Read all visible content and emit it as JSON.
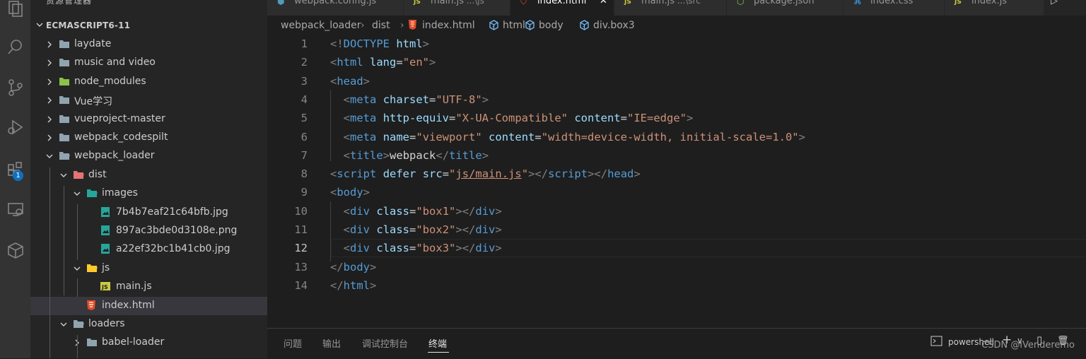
{
  "sidebar": {
    "title": "资源管理器",
    "more": "···",
    "section": "ECMASCRIPT6-11",
    "items": [
      {
        "label": "laydate",
        "type": "folder"
      },
      {
        "label": "music and video",
        "type": "folder"
      },
      {
        "label": "node_modules",
        "type": "folder"
      },
      {
        "label": "Vue学习",
        "type": "folder"
      },
      {
        "label": "vueproject-master",
        "type": "folder"
      },
      {
        "label": "webpack_codespilt",
        "type": "folder"
      },
      {
        "label": "webpack_loader",
        "type": "folder-open"
      },
      {
        "label": "dist",
        "type": "folder-open"
      },
      {
        "label": "images",
        "type": "folder-open"
      },
      {
        "label": "7b4b7eaf21c64bfb.jpg",
        "type": "image"
      },
      {
        "label": "897ac3bde0d3108e.png",
        "type": "image"
      },
      {
        "label": "a22ef32bc1b41cb0.jpg",
        "type": "image"
      },
      {
        "label": "js",
        "type": "folder-open"
      },
      {
        "label": "main.js",
        "type": "js"
      },
      {
        "label": "index.html",
        "type": "html"
      },
      {
        "label": "loaders",
        "type": "folder-open"
      },
      {
        "label": "babel-loader",
        "type": "folder"
      }
    ]
  },
  "activity": {
    "badge": "1",
    "icons": [
      "explorer-icon",
      "search-icon",
      "source-control-icon",
      "run-debug-icon",
      "extensions-icon",
      "remote-explorer-icon",
      "package-icon"
    ]
  },
  "tabs": [
    {
      "label": "webpack.config.js",
      "detail": "",
      "icon": "gear-icon",
      "icon_color": "#519aba"
    },
    {
      "label": "main.js",
      "detail": "...\\js",
      "icon": "js-icon",
      "icon_color": "#cbcb41"
    },
    {
      "label": "index.html",
      "detail": "",
      "icon": "html-icon",
      "icon_color": "#e44d26",
      "active": true
    },
    {
      "label": "main.js",
      "detail": "...\\src",
      "icon": "js-icon",
      "icon_color": "#cbcb41"
    },
    {
      "label": "package.json",
      "detail": "",
      "icon": "node-icon",
      "icon_color": "#8bc34a"
    },
    {
      "label": "index.css",
      "detail": "",
      "icon": "css-icon",
      "icon_color": "#42a5f5"
    },
    {
      "label": "index.js",
      "detail": "",
      "icon": "js-icon",
      "icon_color": "#cbcb41"
    }
  ],
  "breadcrumb": [
    "webpack_loader",
    "dist",
    "index.html",
    "html",
    "body",
    "div.box3"
  ],
  "editor": {
    "current_line": 12,
    "lines": [
      {
        "n": "1",
        "tokens": [
          [
            "punc",
            "<!"
          ],
          [
            "tag",
            "DOCTYPE"
          ],
          [
            "txt",
            " "
          ],
          [
            "attr",
            "html"
          ],
          [
            "punc",
            ">"
          ]
        ]
      },
      {
        "n": "2",
        "tokens": [
          [
            "punc",
            "<"
          ],
          [
            "tag",
            "html"
          ],
          [
            "txt",
            " "
          ],
          [
            "attr",
            "lang"
          ],
          [
            "txt",
            "="
          ],
          [
            "str",
            "\"en\""
          ],
          [
            "punc",
            ">"
          ]
        ]
      },
      {
        "n": "3",
        "tokens": [
          [
            "punc",
            "<"
          ],
          [
            "tag",
            "head"
          ],
          [
            "punc",
            ">"
          ]
        ]
      },
      {
        "n": "4",
        "tokens": [
          [
            "txt",
            "  "
          ],
          [
            "punc",
            "<"
          ],
          [
            "tag",
            "meta"
          ],
          [
            "txt",
            " "
          ],
          [
            "attr",
            "charset"
          ],
          [
            "txt",
            "="
          ],
          [
            "str",
            "\"UTF-8\""
          ],
          [
            "punc",
            ">"
          ]
        ]
      },
      {
        "n": "5",
        "tokens": [
          [
            "txt",
            "  "
          ],
          [
            "punc",
            "<"
          ],
          [
            "tag",
            "meta"
          ],
          [
            "txt",
            " "
          ],
          [
            "attr",
            "http-equiv"
          ],
          [
            "txt",
            "="
          ],
          [
            "str",
            "\"X-UA-Compatible\""
          ],
          [
            "txt",
            " "
          ],
          [
            "attr",
            "content"
          ],
          [
            "txt",
            "="
          ],
          [
            "str",
            "\"IE=edge\""
          ],
          [
            "punc",
            ">"
          ]
        ]
      },
      {
        "n": "6",
        "tokens": [
          [
            "txt",
            "  "
          ],
          [
            "punc",
            "<"
          ],
          [
            "tag",
            "meta"
          ],
          [
            "txt",
            " "
          ],
          [
            "attr",
            "name"
          ],
          [
            "txt",
            "="
          ],
          [
            "str",
            "\"viewport\""
          ],
          [
            "txt",
            " "
          ],
          [
            "attr",
            "content"
          ],
          [
            "txt",
            "="
          ],
          [
            "str",
            "\"width=device-width, initial-scale=1.0\""
          ],
          [
            "punc",
            ">"
          ]
        ]
      },
      {
        "n": "7",
        "tokens": [
          [
            "txt",
            "  "
          ],
          [
            "punc",
            "<"
          ],
          [
            "tag",
            "title"
          ],
          [
            "punc",
            ">"
          ],
          [
            "txt",
            "webpack"
          ],
          [
            "punc",
            "</"
          ],
          [
            "tag",
            "title"
          ],
          [
            "punc",
            ">"
          ]
        ]
      },
      {
        "n": "8",
        "tokens": [
          [
            "punc",
            "<"
          ],
          [
            "tag",
            "script"
          ],
          [
            "txt",
            " "
          ],
          [
            "attr",
            "defer"
          ],
          [
            "txt",
            " "
          ],
          [
            "attr",
            "src"
          ],
          [
            "txt",
            "="
          ],
          [
            "str",
            "\""
          ],
          [
            "strlink",
            "js/main.js"
          ],
          [
            "str",
            "\""
          ],
          [
            "punc",
            "></"
          ],
          [
            "tag",
            "script"
          ],
          [
            "punc",
            "></"
          ],
          [
            "tag",
            "head"
          ],
          [
            "punc",
            ">"
          ]
        ]
      },
      {
        "n": "9",
        "tokens": [
          [
            "punc",
            "<"
          ],
          [
            "tag",
            "body"
          ],
          [
            "punc",
            ">"
          ]
        ]
      },
      {
        "n": "10",
        "tokens": [
          [
            "txt",
            "  "
          ],
          [
            "punc",
            "<"
          ],
          [
            "tag",
            "div"
          ],
          [
            "txt",
            " "
          ],
          [
            "attr",
            "class"
          ],
          [
            "txt",
            "="
          ],
          [
            "str",
            "\"box1\""
          ],
          [
            "punc",
            "></"
          ],
          [
            "tag",
            "div"
          ],
          [
            "punc",
            ">"
          ]
        ]
      },
      {
        "n": "11",
        "tokens": [
          [
            "txt",
            "  "
          ],
          [
            "punc",
            "<"
          ],
          [
            "tag",
            "div"
          ],
          [
            "txt",
            " "
          ],
          [
            "attr",
            "class"
          ],
          [
            "txt",
            "="
          ],
          [
            "str",
            "\"box2\""
          ],
          [
            "punc",
            "></"
          ],
          [
            "tag",
            "div"
          ],
          [
            "punc",
            ">"
          ]
        ]
      },
      {
        "n": "12",
        "tokens": [
          [
            "txt",
            "  "
          ],
          [
            "punc",
            "<"
          ],
          [
            "tag",
            "div"
          ],
          [
            "txt",
            " "
          ],
          [
            "attr",
            "class"
          ],
          [
            "txt",
            "="
          ],
          [
            "str",
            "\"box3\""
          ],
          [
            "punc",
            "></"
          ],
          [
            "tag",
            "div"
          ],
          [
            "punc",
            ">"
          ]
        ]
      },
      {
        "n": "13",
        "tokens": [
          [
            "punc",
            "</"
          ],
          [
            "tag",
            "body"
          ],
          [
            "punc",
            ">"
          ]
        ]
      },
      {
        "n": "14",
        "tokens": [
          [
            "punc",
            "</"
          ],
          [
            "tag",
            "html"
          ],
          [
            "punc",
            ">"
          ]
        ]
      }
    ]
  },
  "panel": {
    "tabs": [
      "问题",
      "输出",
      "调试控制台",
      "终端"
    ],
    "active_tab": "终端",
    "shell": "powershell",
    "actions": [
      "+",
      "∨",
      "▯",
      "🗑"
    ],
    "watermark": "CSDN @iVenderemo"
  }
}
